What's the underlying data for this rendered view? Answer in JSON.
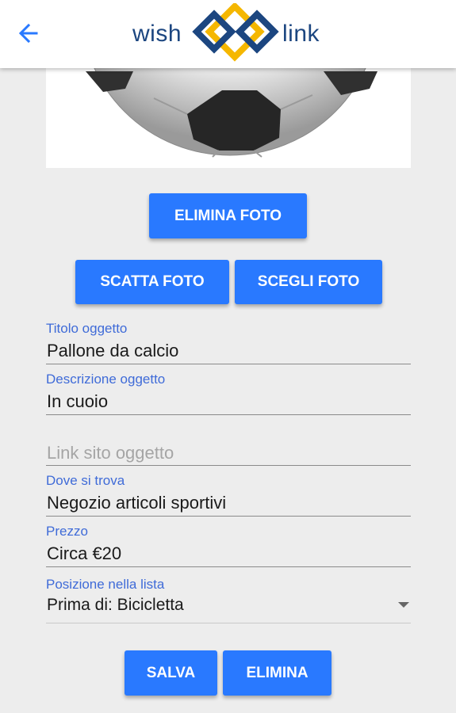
{
  "header": {
    "back_icon": "arrow-left-icon",
    "logo_left": "wish",
    "logo_right": "link",
    "colors": {
      "accent": "#2979ff",
      "logo_blue": "#1c4680",
      "logo_gold": "#f5b700"
    }
  },
  "photo": {
    "content": "soccer-ball-image"
  },
  "buttons": {
    "delete_photo": "ELIMINA FOTO",
    "take_photo": "SCATTA FOTO",
    "choose_photo": "SCEGLI FOTO",
    "save": "SALVA",
    "delete": "ELIMINA"
  },
  "form": {
    "title": {
      "label": "Titolo oggetto",
      "value": "Pallone da calcio"
    },
    "description": {
      "label": "Descrizione oggetto",
      "value": "In cuoio"
    },
    "link": {
      "placeholder": "Link sito oggetto"
    },
    "location": {
      "label": "Dove si trova",
      "value": "Negozio articoli sportivi"
    },
    "price": {
      "label": "Prezzo",
      "value": "Circa €20"
    },
    "position": {
      "label": "Posizione nella lista",
      "value": "Prima di: Bicicletta"
    }
  }
}
